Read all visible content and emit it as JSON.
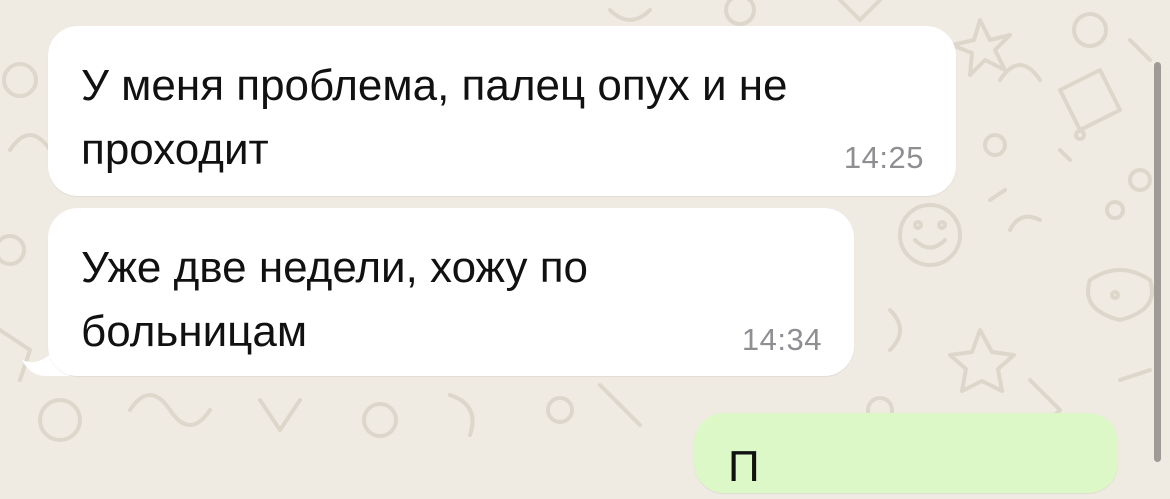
{
  "chat": {
    "messages": [
      {
        "direction": "incoming",
        "text": "У меня проблема, палец опух и не\nпроходит",
        "time": "14:25"
      },
      {
        "direction": "incoming",
        "text": "Уже две недели, хожу по\nбольницам",
        "time": "14:34"
      },
      {
        "direction": "outgoing",
        "text": "П",
        "time": ""
      }
    ]
  },
  "colors": {
    "wallpaper": "#efeae2",
    "incoming_bubble": "#ffffff",
    "outgoing_bubble": "#dcf8c6",
    "text": "#111111",
    "timestamp": "#8e8e93"
  }
}
